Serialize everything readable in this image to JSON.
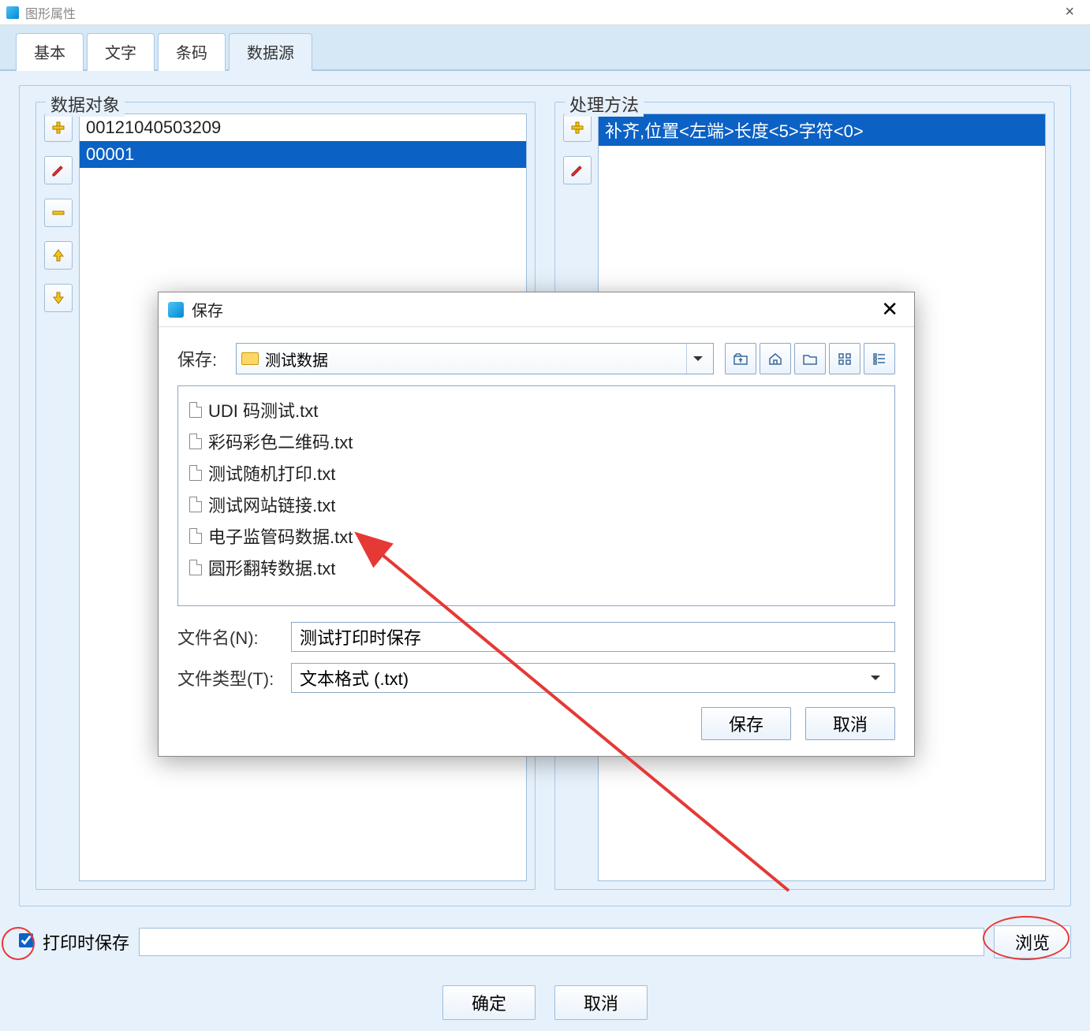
{
  "window": {
    "title": "图形属性"
  },
  "tabs": {
    "basic": "基本",
    "text": "文字",
    "barcode": "条码",
    "datasource": "数据源"
  },
  "left_group": {
    "label": "数据对象",
    "items": [
      "00121040503209",
      "00001"
    ],
    "selected_index": 1
  },
  "right_group": {
    "label": "处理方法",
    "items": [
      "补齐,位置<左端>长度<5>字符<0>"
    ],
    "selected_index": 0
  },
  "save_on_print": {
    "label": "打印时保存",
    "checked": true,
    "path": ""
  },
  "browse_button": "浏览",
  "footer": {
    "ok": "确定",
    "cancel": "取消"
  },
  "save_dialog": {
    "title": "保存",
    "location_label": "保存:",
    "location_value": "测试数据",
    "files": [
      "UDI 码测试.txt",
      "彩码彩色二维码.txt",
      "测试随机打印.txt",
      "测试网站链接.txt",
      "电子监管码数据.txt",
      "圆形翻转数据.txt"
    ],
    "filename_label": "文件名(N):",
    "filename_value": "测试打印时保存",
    "filetype_label": "文件类型(T):",
    "filetype_value": "文本格式 (.txt)",
    "save": "保存",
    "cancel": "取消"
  }
}
